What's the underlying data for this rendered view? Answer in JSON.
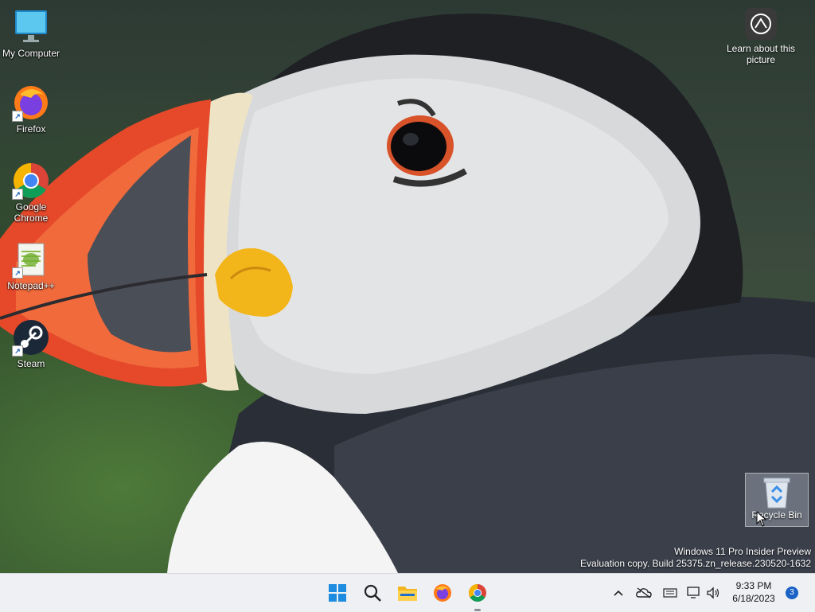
{
  "desktop": {
    "icons": [
      {
        "label": "My Computer",
        "icon": "monitor-icon"
      },
      {
        "label": "Firefox",
        "icon": "firefox-icon"
      },
      {
        "label": "Google Chrome",
        "icon": "chrome-icon"
      },
      {
        "label": "Notepad++",
        "icon": "notepadpp-icon"
      },
      {
        "label": "Steam",
        "icon": "steam-icon"
      }
    ],
    "learn_about_picture": "Learn about this picture",
    "recycle_bin": "Recycle Bin",
    "watermark": {
      "line1": "Windows 11 Pro Insider Preview",
      "line2": "Evaluation copy. Build 25375.zn_release.230520-1632"
    }
  },
  "taskbar": {
    "apps": [
      "start-icon",
      "search-icon",
      "file-explorer-icon",
      "firefox-icon",
      "chrome-icon"
    ],
    "tray": [
      "chevron-up-icon",
      "onedrive-icon",
      "keyboard-icon",
      "network-icon",
      "volume-icon"
    ],
    "time": "9:33 PM",
    "date": "6/18/2023",
    "notification_count": "3"
  }
}
